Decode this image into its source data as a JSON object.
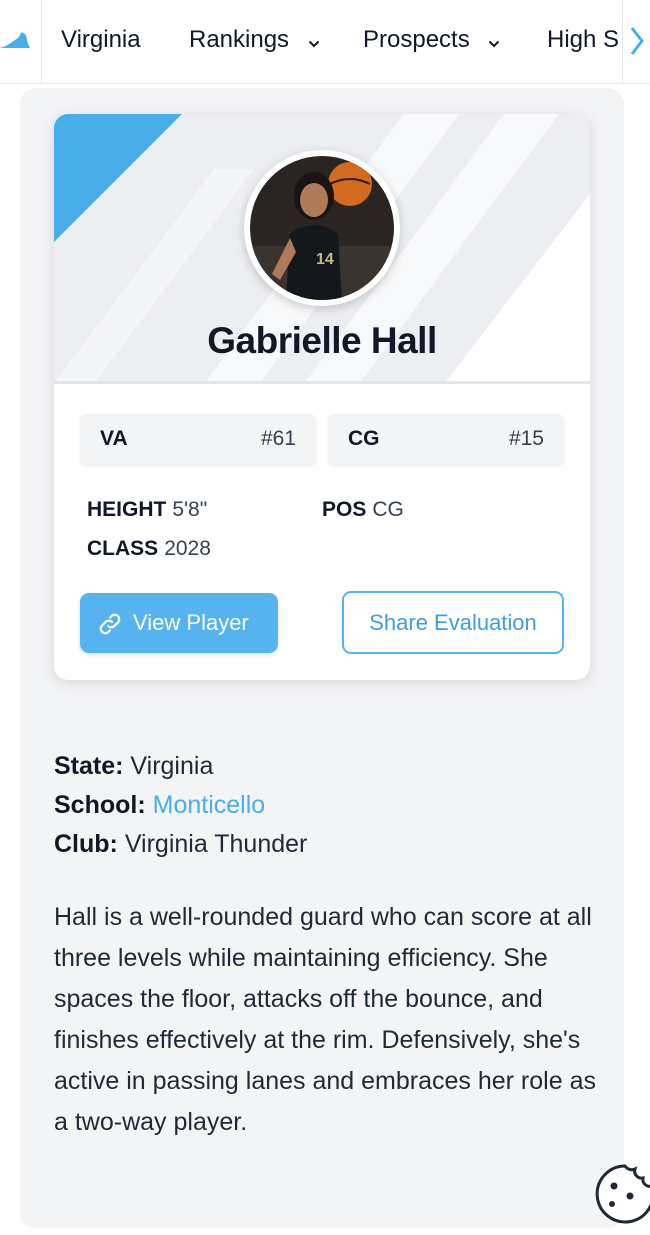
{
  "nav": {
    "items": [
      "Virginia",
      "Rankings",
      "Prospects",
      "High S"
    ],
    "logo_icon": "virginia-state-icon",
    "scroll_icon": "chevron-right-icon"
  },
  "player": {
    "name": "Gabrielle Hall",
    "photo_icon": "player-photo",
    "state_rank": {
      "code": "VA",
      "rank": "#61"
    },
    "position_rank": {
      "code": "CG",
      "rank": "#15"
    },
    "height_label": "HEIGHT",
    "height": "5'8\"",
    "pos_label": "POS",
    "pos": "CG",
    "class_label": "CLASS",
    "class_year": "2028"
  },
  "actions": {
    "view_player": "View Player",
    "share_evaluation": "Share Evaluation"
  },
  "details": {
    "state_label": "State:",
    "state": "Virginia",
    "school_label": "School:",
    "school": "Monticello",
    "club_label": "Club:",
    "club": "Virginia Thunder"
  },
  "bio": "Hall is a well-rounded guard who can score at all three levels while maintaining efficiency. She spaces the floor, attacks off the bounce, and finishes effectively at the rim. Defensively, she's active in passing lanes and embraces her role as a two-way player.",
  "colors": {
    "accent": "#55b3f0",
    "link": "#4aaee8",
    "panel": "#f3f4f6",
    "text": "#111827"
  }
}
